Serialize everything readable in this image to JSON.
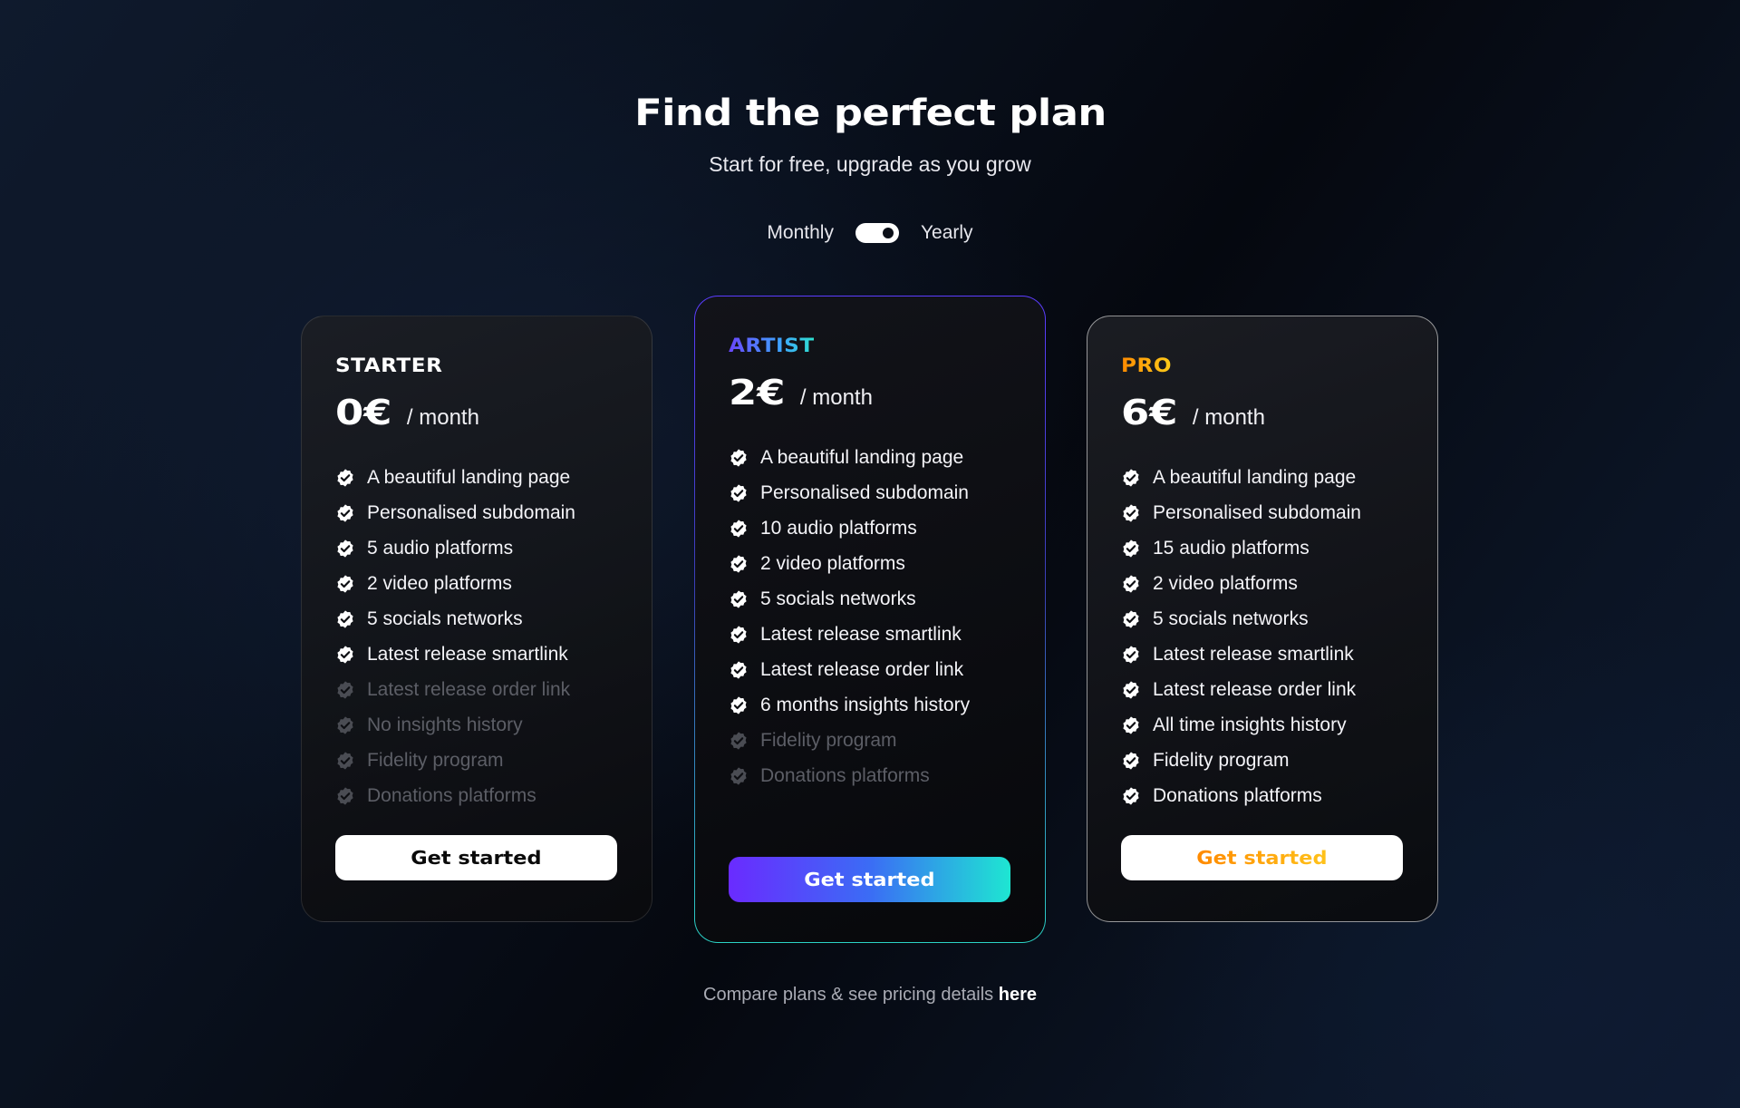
{
  "header": {
    "title": "Find the perfect plan",
    "subtitle": "Start for free, upgrade as you grow"
  },
  "billing_toggle": {
    "monthly_label": "Monthly",
    "yearly_label": "Yearly",
    "selected": "Yearly"
  },
  "plans": [
    {
      "name": "STARTER",
      "price": "0€",
      "period": "/ month",
      "cta": "Get started",
      "features": [
        {
          "label": "A beautiful landing page",
          "included": true
        },
        {
          "label": "Personalised subdomain",
          "included": true
        },
        {
          "label": "5 audio platforms",
          "included": true
        },
        {
          "label": "2 video platforms",
          "included": true
        },
        {
          "label": "5 socials networks",
          "included": true
        },
        {
          "label": "Latest release smartlink",
          "included": true
        },
        {
          "label": "Latest release order link",
          "included": false
        },
        {
          "label": "No insights history",
          "included": false
        },
        {
          "label": "Fidelity program",
          "included": false
        },
        {
          "label": "Donations platforms",
          "included": false
        }
      ]
    },
    {
      "name": "ARTIST",
      "price": "2€",
      "period": "/ month",
      "cta": "Get started",
      "features": [
        {
          "label": "A beautiful landing page",
          "included": true
        },
        {
          "label": "Personalised subdomain",
          "included": true
        },
        {
          "label": "10 audio platforms",
          "included": true
        },
        {
          "label": "2 video platforms",
          "included": true
        },
        {
          "label": "5 socials networks",
          "included": true
        },
        {
          "label": "Latest release smartlink",
          "included": true
        },
        {
          "label": "Latest release order link",
          "included": true
        },
        {
          "label": "6 months insights history",
          "included": true
        },
        {
          "label": "Fidelity program",
          "included": false
        },
        {
          "label": "Donations platforms",
          "included": false
        }
      ]
    },
    {
      "name": "PRO",
      "price": "6€",
      "period": "/ month",
      "cta": "Get started",
      "features": [
        {
          "label": "A beautiful landing page",
          "included": true
        },
        {
          "label": "Personalised subdomain",
          "included": true
        },
        {
          "label": "15 audio platforms",
          "included": true
        },
        {
          "label": "2 video platforms",
          "included": true
        },
        {
          "label": "5 socials networks",
          "included": true
        },
        {
          "label": "Latest release smartlink",
          "included": true
        },
        {
          "label": "Latest release order link",
          "included": true
        },
        {
          "label": "All time insights history",
          "included": true
        },
        {
          "label": "Fidelity program",
          "included": true
        },
        {
          "label": "Donations platforms",
          "included": true
        }
      ]
    }
  ],
  "footer": {
    "text": "Compare plans & see pricing details",
    "link_label": "here"
  },
  "colors": {
    "artist_gradient_start": "#6a2bff",
    "artist_gradient_end": "#1ee6d2",
    "pro_gradient_start": "#ff8a00",
    "pro_gradient_end": "#ffc21a",
    "disabled_text": "#5c5e66"
  },
  "icons": {
    "feature_check": "check-circle-icon"
  }
}
